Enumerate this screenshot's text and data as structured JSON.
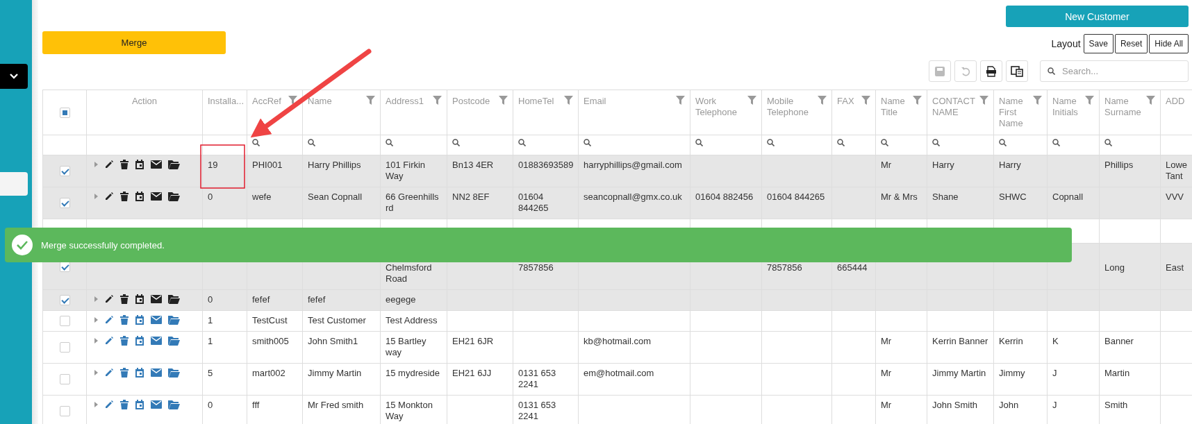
{
  "top_buttons": {
    "merge": "Merge",
    "new_customer": "New Customer"
  },
  "layout": {
    "label": "Layout",
    "buttons": [
      "Save",
      "Reset",
      "Hide All"
    ]
  },
  "toolbar": {
    "buttons": [
      {
        "kind": "save",
        "disabled": true
      },
      {
        "kind": "undo",
        "disabled": true
      },
      {
        "kind": "export",
        "disabled": false
      },
      {
        "kind": "columns",
        "disabled": false
      }
    ],
    "search": {
      "placeholder": "Search..."
    }
  },
  "table": {
    "header_checkbox": {
      "partial": true
    },
    "columns": [
      {
        "label": "Action",
        "filterable": false
      },
      {
        "label": "Installa...",
        "filterable": false
      },
      {
        "label": "AccRef",
        "filterable": true
      },
      {
        "label": "Name",
        "filterable": true
      },
      {
        "label": "Address1",
        "filterable": true
      },
      {
        "label": "Postcode",
        "filterable": true
      },
      {
        "label": "HomeTel",
        "filterable": true
      },
      {
        "label": "Email",
        "filterable": true
      },
      {
        "label": "Work Telephone",
        "filterable": true
      },
      {
        "label": "Mobile Telephone",
        "filterable": true
      },
      {
        "label": "FAX",
        "filterable": true
      },
      {
        "label": "Name Title",
        "filterable": true
      },
      {
        "label": "CONTACT NAME",
        "filterable": true
      },
      {
        "label": "Name First Name",
        "filterable": true
      },
      {
        "label": "Name Initials",
        "filterable": true
      },
      {
        "label": "Name Surname",
        "filterable": true
      },
      {
        "label": "ADD",
        "filterable": false
      }
    ],
    "rows": [
      {
        "checked": true,
        "covered": false,
        "cells": [
          "",
          "19",
          "PHI001",
          "Harry Phillips",
          "101 Firkin Way",
          "Bn13 4ER",
          "01883693589",
          "harryphillips@gmail.com",
          "",
          "",
          "",
          "Mr",
          "Harry",
          "Harry",
          "",
          "Phillips",
          "Lowe Tant"
        ]
      },
      {
        "checked": true,
        "covered": false,
        "cells": [
          "",
          "0",
          "wefe",
          "Sean Copnall",
          "66 Greenhills rd",
          "NN2 8EF",
          "01604 844265",
          "seancopnall@gmx.co.uk",
          "01604 882456",
          "01604 844265",
          "",
          "Mr & Mrs",
          "Shane",
          "SHWC",
          "Copnall",
          "",
          "VVV"
        ]
      },
      {
        "covered": true,
        "cells": [
          "",
          "",
          "",
          "",
          "",
          "",
          "",
          "",
          "",
          "",
          "",
          "",
          "",
          "",
          "",
          "",
          ""
        ]
      },
      {
        "checked": true,
        "covered": true,
        "cells": [
          "",
          "",
          "",
          "",
          "Chelmsford Road",
          "",
          "7857856",
          "",
          "",
          "7857856",
          "665444",
          "",
          "",
          "",
          "",
          "Long",
          "East"
        ]
      },
      {
        "checked": true,
        "covered": false,
        "cells": [
          "",
          "0",
          "fefef",
          "fefef",
          "eegege",
          "",
          "",
          "",
          "",
          "",
          "",
          "",
          "",
          "",
          "",
          "",
          ""
        ]
      },
      {
        "checked": false,
        "covered": false,
        "cells": [
          "",
          "1",
          "TestCust",
          "Test Customer",
          "Test Address",
          "",
          "",
          "",
          "",
          "",
          "",
          "",
          "",
          "",
          "",
          "",
          ""
        ]
      },
      {
        "checked": false,
        "covered": false,
        "cells": [
          "",
          "1",
          "smith005",
          "John Smith1",
          "15 Bartley way",
          "EH21 6JR",
          "",
          "kb@hotmail.com",
          "",
          "",
          "",
          "Mr",
          "Kerrin Banner",
          "Kerrin",
          "K",
          "Banner",
          ""
        ]
      },
      {
        "checked": false,
        "covered": false,
        "cells": [
          "",
          "5",
          "mart002",
          "Jimmy Martin",
          "15 mydreside",
          "EH21 6JJ",
          "0131 653 2241",
          "em@hotmail.com",
          "",
          "",
          "",
          "Mr",
          "Jimmy Martin",
          "Jimmy",
          "J",
          "Martin",
          ""
        ]
      },
      {
        "checked": false,
        "covered": false,
        "cells": [
          "",
          "0",
          "fff",
          "Mr Fred smith",
          "15 Monkton Way",
          "",
          "0131 653 2241",
          "",
          "",
          "",
          "",
          "Mr",
          "John Smith",
          "John",
          "J",
          "Smith",
          ""
        ]
      }
    ]
  },
  "toast": {
    "kind": "success",
    "message": "Merge successfully completed."
  },
  "annotations": [
    {
      "kind": "arrow"
    },
    {
      "kind": "highlight_box"
    }
  ]
}
